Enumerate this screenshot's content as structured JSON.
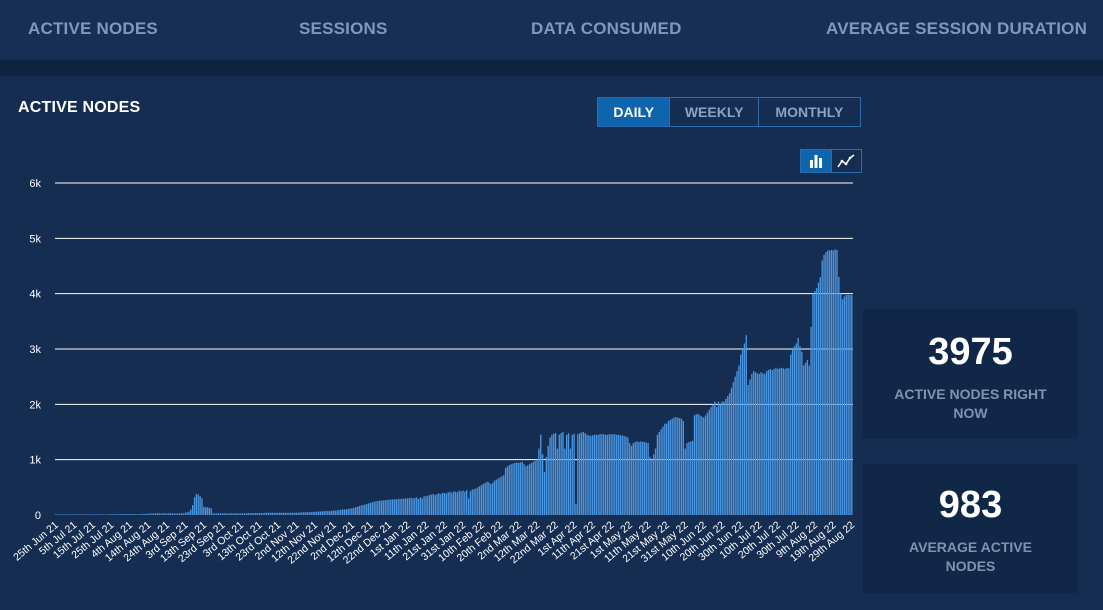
{
  "nav": {
    "tabs": [
      {
        "label": "ACTIVE NODES"
      },
      {
        "label": "SESSIONS"
      },
      {
        "label": "DATA CONSUMED"
      },
      {
        "label": "AVERAGE SESSION DURATION"
      }
    ]
  },
  "chart_panel": {
    "title": "ACTIVE NODES",
    "period_options": [
      "DAILY",
      "WEEKLY",
      "MONTHLY"
    ],
    "selected_period": "DAILY",
    "chart_type_options": [
      {
        "icon": "bar-chart-icon",
        "selected": true
      },
      {
        "icon": "line-chart-icon",
        "selected": false
      }
    ]
  },
  "stats": [
    {
      "value": "3975",
      "label": "ACTIVE NODES RIGHT NOW"
    },
    {
      "value": "983",
      "label": "AVERAGE ACTIVE NODES"
    }
  ],
  "colors": {
    "background": "#162d52",
    "bar": "#4b96e0",
    "accent": "#0e65ad",
    "card": "#112748"
  },
  "chart_data": {
    "type": "bar",
    "title": "ACTIVE NODES",
    "xlabel": "",
    "ylabel": "",
    "ylim": [
      0,
      6000
    ],
    "y_ticks": [
      "0",
      "1k",
      "2k",
      "3k",
      "4k",
      "5k",
      "6k"
    ],
    "grid": true,
    "x_ticks": [
      "25th Jun 21",
      "5th Jul 21",
      "15th Jul 21",
      "25th Jul 21",
      "4th Aug 21",
      "14th Aug 21",
      "24th Aug 21",
      "3rd Sep 21",
      "13th Sep 21",
      "23rd Sep 21",
      "3rd Oct 21",
      "13th Oct 21",
      "23rd Oct 21",
      "2nd Nov 21",
      "12th Nov 21",
      "22nd Nov 21",
      "2nd Dec 21",
      "12th Dec 21",
      "22nd Dec 21",
      "1st Jan 22",
      "11th Jan 22",
      "21st Jan 22",
      "31st Jan 22",
      "10th Feb 22",
      "20th Feb 22",
      "2nd Mar 22",
      "12th Mar 22",
      "22nd Mar 22",
      "1st Apr 22",
      "11th Apr 22",
      "21st Apr 22",
      "1st May 22",
      "11th May 22",
      "21st May 22",
      "31st May 22",
      "10th Jun 22",
      "20th Jun 22",
      "30th Jun 22",
      "10th Jul 22",
      "20th Jul 22",
      "30th Jul 22",
      "9th Aug 22",
      "19th Aug 22",
      "29th Aug 22"
    ],
    "series_by_period": [
      {
        "from": "25th Jun 21",
        "values": [
          0,
          0,
          0,
          0,
          0,
          0,
          0,
          0,
          0,
          0
        ]
      },
      {
        "from": "5th Jul 21",
        "values": [
          0,
          0,
          5,
          5,
          5,
          5,
          5,
          5,
          5,
          5
        ]
      },
      {
        "from": "15th Jul 21",
        "values": [
          10,
          10,
          10,
          10,
          10,
          10,
          10,
          10,
          10,
          10
        ]
      },
      {
        "from": "25th Jul 21",
        "values": [
          15,
          15,
          15,
          15,
          15,
          15,
          15,
          15,
          15,
          15
        ]
      },
      {
        "from": "4th Aug 21",
        "values": [
          15,
          15,
          15,
          15,
          15,
          15,
          15,
          20,
          20,
          20
        ]
      },
      {
        "from": "14th Aug 21",
        "values": [
          25,
          25,
          30,
          30,
          30,
          30,
          30,
          30,
          30,
          30
        ]
      },
      {
        "from": "24th Aug 21",
        "values": [
          30,
          30,
          30,
          30,
          30,
          30,
          30,
          30,
          30,
          30
        ]
      },
      {
        "from": "3rd Sep 21",
        "values": [
          40,
          50,
          60,
          100,
          180,
          320,
          380,
          370,
          340,
          300
        ]
      },
      {
        "from": "13th Sep 21",
        "values": [
          150,
          140,
          140,
          130,
          120,
          30,
          30,
          30,
          30,
          30
        ]
      },
      {
        "from": "23rd Sep 21",
        "values": [
          30,
          30,
          30,
          30,
          30,
          30,
          30,
          30,
          30,
          30
        ]
      },
      {
        "from": "3rd Oct 21",
        "values": [
          30,
          30,
          30,
          35,
          35,
          35,
          35,
          35,
          35,
          35
        ]
      },
      {
        "from": "13th Oct 21",
        "values": [
          35,
          35,
          35,
          40,
          40,
          40,
          40,
          40,
          40,
          40
        ]
      },
      {
        "from": "23rd Oct 21",
        "values": [
          40,
          40,
          40,
          40,
          40,
          40,
          40,
          40,
          40,
          40
        ]
      },
      {
        "from": "2nd Nov 21",
        "values": [
          40,
          45,
          45,
          45,
          50,
          50,
          50,
          50,
          55,
          55
        ]
      },
      {
        "from": "12th Nov 21",
        "values": [
          60,
          60,
          60,
          65,
          65,
          70,
          70,
          70,
          70,
          75
        ]
      },
      {
        "from": "22nd Nov 21",
        "values": [
          80,
          80,
          85,
          90,
          95,
          100,
          100,
          105,
          110,
          115
        ]
      },
      {
        "from": "2nd Dec 21",
        "values": [
          120,
          130,
          140,
          150,
          160,
          170,
          180,
          190,
          200,
          210
        ]
      },
      {
        "from": "12th Dec 21",
        "values": [
          220,
          230,
          240,
          250,
          255,
          260,
          260,
          265,
          270,
          270
        ]
      },
      {
        "from": "22nd Dec 21",
        "values": [
          275,
          280,
          280,
          285,
          285,
          290,
          290,
          295,
          295,
          300
        ]
      },
      {
        "from": "1st Jan 22",
        "values": [
          300,
          305,
          310,
          300,
          310,
          320,
          290,
          320,
          300,
          340
        ]
      },
      {
        "from": "11th Jan 22",
        "values": [
          340,
          350,
          360,
          370,
          380,
          360,
          380,
          390,
          380,
          400
        ]
      },
      {
        "from": "21st Jan 22",
        "values": [
          400,
          390,
          410,
          420,
          400,
          430,
          420,
          410,
          440,
          430
        ]
      },
      {
        "from": "31st Jan 22",
        "values": [
          440,
          420,
          450,
          300,
          430,
          460,
          470,
          480,
          500,
          520
        ]
      },
      {
        "from": "10th Feb 22",
        "values": [
          540,
          560,
          580,
          600,
          590,
          560,
          580,
          620,
          640,
          660
        ]
      },
      {
        "from": "20th Feb 22",
        "values": [
          680,
          700,
          720,
          850,
          880,
          900,
          920,
          930,
          940,
          950
        ]
      },
      {
        "from": "2nd Mar 22",
        "values": [
          940,
          950,
          960,
          920,
          880,
          900,
          920,
          940,
          960,
          980
        ]
      },
      {
        "from": "12th Mar 22",
        "values": [
          1000,
          1200,
          1450,
          1100,
          780,
          1050,
          1250,
          1400,
          1450,
          1470
        ]
      },
      {
        "from": "22nd Mar 22",
        "values": [
          1480,
          1200,
          1450,
          1480,
          1500,
          1200,
          1450,
          1480,
          1200,
          1450
        ]
      },
      {
        "from": "1st Apr 22",
        "values": [
          1470,
          200,
          1460,
          1480,
          1490,
          1500,
          1480,
          1450,
          1440,
          1430
        ]
      },
      {
        "from": "11th Apr 22",
        "values": [
          1440,
          1450,
          1450,
          1450,
          1460,
          1460,
          1460,
          1450,
          1450,
          1460
        ]
      },
      {
        "from": "21st Apr 22",
        "values": [
          1460,
          1460,
          1460,
          1450,
          1450,
          1440,
          1440,
          1430,
          1420,
          1400
        ]
      },
      {
        "from": "1st May 22",
        "values": [
          1300,
          1250,
          1300,
          1320,
          1330,
          1320,
          1330,
          1320,
          1320,
          1310
        ]
      },
      {
        "from": "11th May 22",
        "values": [
          1300,
          1050,
          1000,
          1100,
          1200,
          1450,
          1500,
          1550,
          1600,
          1650
        ]
      },
      {
        "from": "21st May 22",
        "values": [
          1650,
          1700,
          1720,
          1740,
          1760,
          1770,
          1760,
          1750,
          1740,
          1700
        ]
      },
      {
        "from": "31st May 22",
        "values": [
          1200,
          1300,
          1320,
          1330,
          1340,
          1800,
          1820,
          1830,
          1800,
          1780
        ]
      },
      {
        "from": "10th Jun 22",
        "values": [
          1760,
          1800,
          1850,
          1900,
          1950,
          2000,
          2050,
          1950,
          2050,
          2000
        ]
      },
      {
        "from": "20th Jun 22",
        "values": [
          2050,
          2050,
          2100,
          2150,
          2200,
          2300,
          2400,
          2500,
          2600,
          2700
        ]
      },
      {
        "from": "30th Jun 22",
        "values": [
          2900,
          3000,
          3100,
          3250,
          2350,
          2450,
          2550,
          2600,
          2580,
          2560
        ]
      },
      {
        "from": "10th Jul 22",
        "values": [
          2550,
          2580,
          2560,
          2550,
          2600,
          2620,
          2640,
          2620,
          2640,
          2660
        ]
      },
      {
        "from": "20th Jul 22",
        "values": [
          2640,
          2650,
          2660,
          2650,
          2640,
          2660,
          2650,
          2900,
          3000,
          3050
        ]
      },
      {
        "from": "30th Jul 22",
        "values": [
          3100,
          3200,
          3050,
          2950,
          2700,
          2750,
          2800,
          2700,
          3400,
          4000
        ]
      },
      {
        "from": "9th Aug 22",
        "values": [
          4050,
          4100,
          4200,
          4300,
          4600,
          4700,
          4750,
          4780,
          4780,
          4790
        ]
      },
      {
        "from": "19th Aug 22",
        "values": [
          4780,
          4800,
          4790,
          4300,
          4000,
          3900,
          3950,
          3975,
          3980,
          3975
        ]
      },
      {
        "from": "29th Aug 22",
        "values": [
          3975
        ]
      }
    ]
  }
}
